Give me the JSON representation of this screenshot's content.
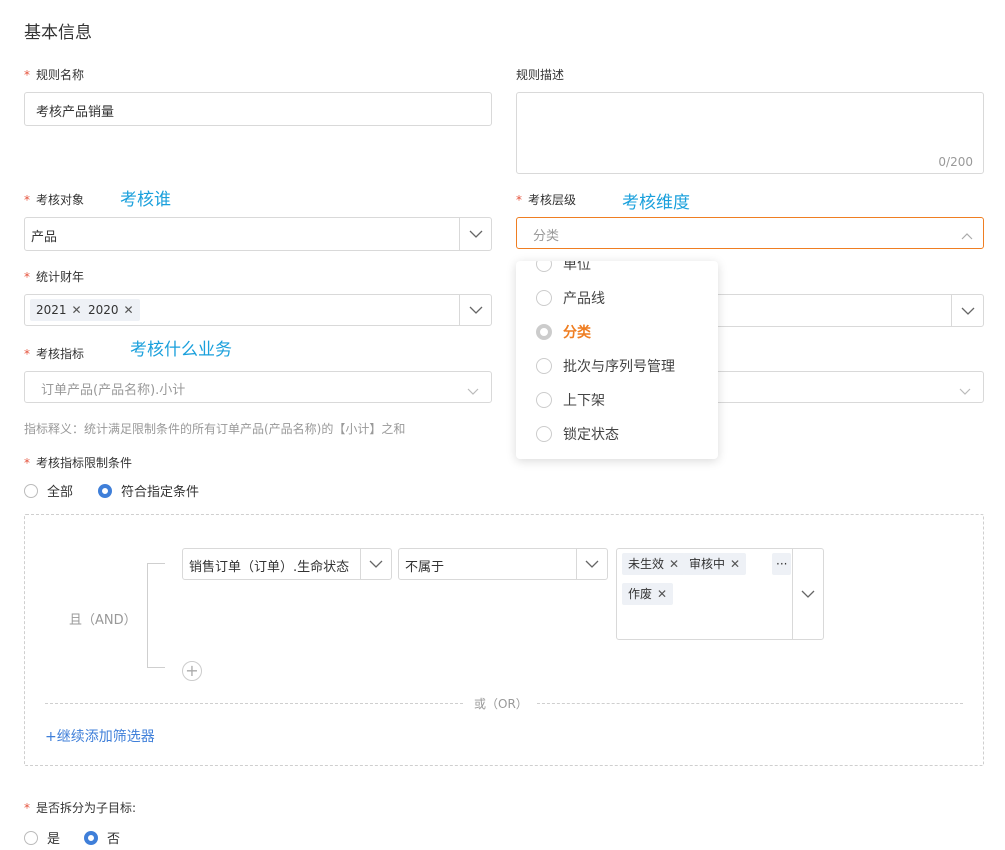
{
  "section_title": "基本信息",
  "fields": {
    "rule_name": {
      "label": "规则名称",
      "value": "考核产品销量"
    },
    "rule_desc": {
      "label": "规则描述",
      "counter": "0/200"
    },
    "target": {
      "label": "考核对象",
      "value": "产品",
      "annotation": "考核谁"
    },
    "level": {
      "label": "考核层级",
      "placeholder": "分类",
      "annotation": "考核维度"
    },
    "fiscal_year": {
      "label": "统计财年",
      "tags": [
        "2021",
        "2020"
      ]
    },
    "indicator": {
      "label": "考核指标",
      "value": "订单产品(产品名称).小计",
      "annotation": "考核什么业务"
    },
    "indicator_note": "指标释义：统计满足限制条件的所有订单产品(产品名称)的【小计】之和",
    "constraint": {
      "label": "考核指标限制条件",
      "options": [
        "全部",
        "符合指定条件"
      ],
      "selected": "符合指定条件"
    },
    "split": {
      "label": "是否拆分为子目标:",
      "options": [
        "是",
        "否"
      ],
      "selected": "否"
    }
  },
  "level_dropdown": {
    "items": [
      "单位",
      "产品线",
      "分类",
      "批次与序列号管理",
      "上下架",
      "锁定状态"
    ],
    "selected": "分类"
  },
  "filter": {
    "and_label": "且（AND）",
    "or_label": "或（OR）",
    "field": "销售订单（订单）.生命状态",
    "operator": "不属于",
    "values": [
      "未生效",
      "审核中",
      "作废"
    ],
    "more": "···",
    "add_filter": "+继续添加筛选器"
  },
  "colors": {
    "accent_orange": "#ef7e22",
    "accent_blue": "#3f7fd9",
    "annotation": "#1aa0dc",
    "required": "#e5533d"
  }
}
